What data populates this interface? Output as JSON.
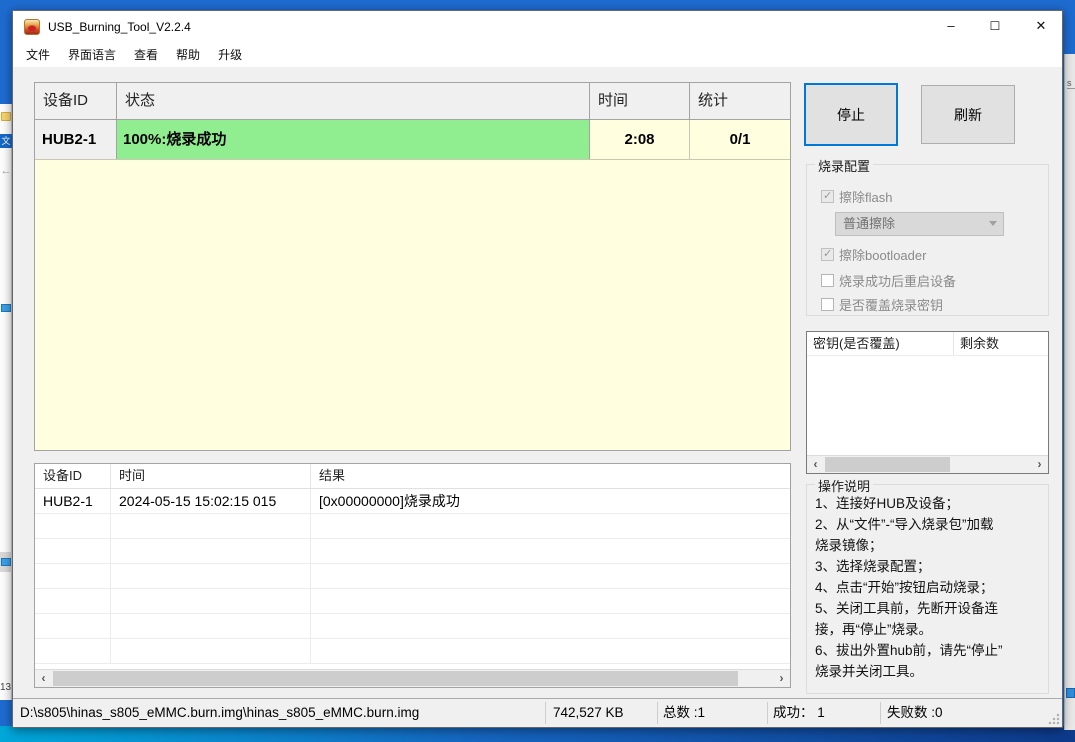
{
  "window": {
    "title": "USB_Burning_Tool_V2.2.4",
    "controls": {
      "minimize": "–",
      "maximize": "☐",
      "close": "✕"
    }
  },
  "menu": {
    "items": [
      {
        "label": "文件"
      },
      {
        "label": "界面语言"
      },
      {
        "label": "查看"
      },
      {
        "label": "帮助"
      },
      {
        "label": "升级"
      }
    ]
  },
  "device_table": {
    "headers": {
      "id": "设备ID",
      "status": "状态",
      "time": "时间",
      "stats": "统计"
    },
    "rows": [
      {
        "id": "HUB2-1",
        "status": "100%:烧录成功",
        "time": "2:08",
        "stats": "0/1",
        "progress_percent": 100
      }
    ]
  },
  "toolbar": {
    "stop_label": "停止",
    "refresh_label": "刷新"
  },
  "burn_config": {
    "title": "烧录配置",
    "options": [
      {
        "label": "擦除flash",
        "checked": true,
        "enabled": false
      },
      {
        "label": "擦除bootloader",
        "checked": true,
        "enabled": false
      },
      {
        "label": "烧录成功后重启设备",
        "checked": false,
        "enabled": false
      },
      {
        "label": "是否覆盖烧录密钥",
        "checked": false,
        "enabled": false
      }
    ],
    "erase_mode": {
      "value": "普通擦除",
      "enabled": false
    }
  },
  "key_table": {
    "headers": {
      "key": "密钥(是否覆盖)",
      "remaining": "剩余数"
    },
    "rows": []
  },
  "instructions": {
    "title": "操作说明",
    "lines": [
      "1、连接好HUB及设备；",
      "2、从“文件”-“导入烧录包”加载",
      "烧录镜像；",
      "3、选择烧录配置；",
      "4、点击“开始”按钮启动烧录；",
      "5、关闭工具前，先断开设备连",
      "接，再“停止”烧录。",
      "6、拔出外置hub前，请先“停止”",
      "烧录并关闭工具。"
    ]
  },
  "log_table": {
    "headers": {
      "id": "设备ID",
      "time": "时间",
      "result": "结果"
    },
    "rows": [
      {
        "id": "HUB2-1",
        "time": "2024-05-15 15:02:15 015",
        "result": "[0x00000000]烧录成功"
      }
    ]
  },
  "status_bar": {
    "file_path": "D:\\s805\\hinas_s805_eMMC.burn.img\\hinas_s805_eMMC.burn.img",
    "file_size": "742,527 KB",
    "total": "总数 :1",
    "success": "成功： 1",
    "failed": "失败数 :0"
  },
  "scrollbar": {
    "left_arrow": "‹",
    "right_arrow": "›"
  },
  "background": {
    "left_edge_translate_icon_text": "文",
    "left_edge_back_arrow": "←",
    "left_edge_number": "13",
    "right_edge_fragment": "s"
  },
  "colors": {
    "accent_blue": "#0078d7",
    "progress_green": "#90ee90",
    "list_bg_yellow": "#ffffe0",
    "desktop_blue": "#1e6bd0"
  }
}
